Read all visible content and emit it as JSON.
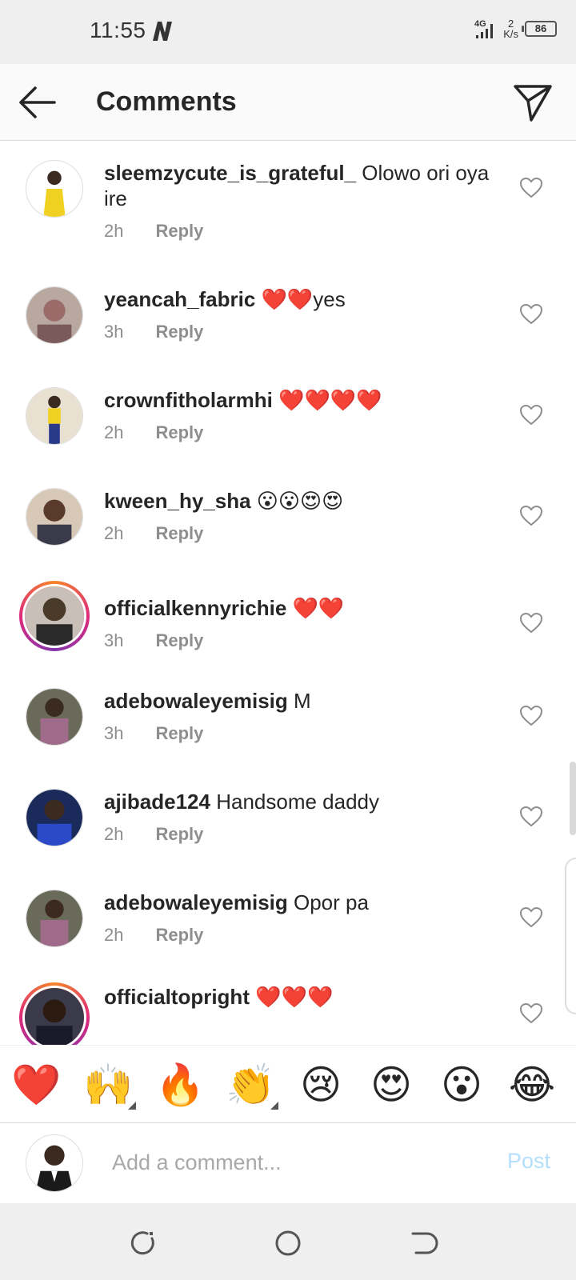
{
  "status_bar": {
    "time": "11:55",
    "network_label": "4G",
    "speed_value": "2",
    "speed_unit": "K/s",
    "battery": "86"
  },
  "header": {
    "title": "Comments",
    "back_icon": "arrow-left-icon",
    "send_icon": "paper-plane-icon"
  },
  "comments": [
    {
      "username": "sleemzycute_is_grateful_",
      "text": "Olowo ori oya ire",
      "time": "2h",
      "reply_label": "Reply",
      "avatar_color": "#f5d90a",
      "story_ring": false
    },
    {
      "username": "yeancah_fabric",
      "text": "❤️❤️yes",
      "time": "3h",
      "reply_label": "Reply",
      "avatar_color": "#9b6b6a",
      "story_ring": false
    },
    {
      "username": "crownfitholarmhi",
      "text": "❤️❤️❤️❤️",
      "time": "2h",
      "reply_label": "Reply",
      "avatar_color": "#c9a336",
      "story_ring": false
    },
    {
      "username": "kween_hy_sha",
      "text": "😮😮😍😍",
      "time": "2h",
      "reply_label": "Reply",
      "avatar_color": "#6a4a3a",
      "story_ring": false
    },
    {
      "username": "officialkennyrichie",
      "text": "❤️❤️",
      "time": "3h",
      "reply_label": "Reply",
      "avatar_color": "#7a6a5a",
      "story_ring": true
    },
    {
      "username": "adebowaleyemisig",
      "text": "M",
      "time": "3h",
      "reply_label": "Reply",
      "avatar_color": "#8a5a6a",
      "story_ring": false
    },
    {
      "username": "ajibade124",
      "text": "Handsome daddy",
      "time": "2h",
      "reply_label": "Reply",
      "avatar_color": "#2a3a8a",
      "story_ring": false
    },
    {
      "username": "adebowaleyemisig",
      "text": "Opor pa",
      "time": "2h",
      "reply_label": "Reply",
      "avatar_color": "#8a5a6a",
      "story_ring": false
    },
    {
      "username": "officialtopright",
      "text": "❤️❤️❤️",
      "time": "",
      "reply_label": "",
      "avatar_color": "#2a2a3a",
      "story_ring": true
    }
  ],
  "emoji_bar": [
    "❤️",
    "🙌",
    "🔥",
    "👏",
    "😢",
    "😍",
    "😮",
    "😂"
  ],
  "input_bar": {
    "placeholder": "Add a comment...",
    "post_label": "Post"
  },
  "colors": {
    "post_disabled": "#b3dffc",
    "meta_gray": "#8e8e8e"
  }
}
